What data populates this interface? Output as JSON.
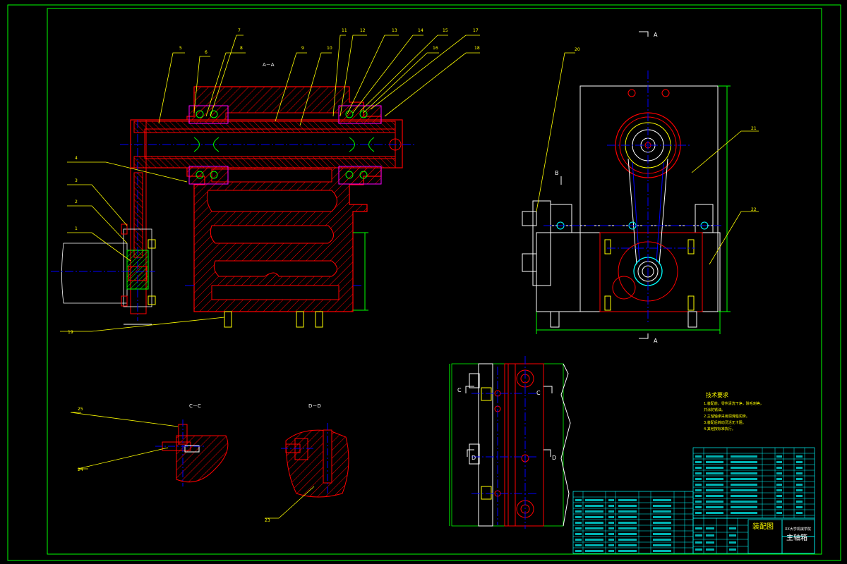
{
  "views": {
    "section_aa": "A－A",
    "section_cc": "C－C",
    "section_dd": "D－D"
  },
  "callouts": {
    "main": [
      "7",
      "5",
      "6",
      "8",
      "9",
      "10",
      "11",
      "12",
      "13",
      "14",
      "15",
      "17",
      "16",
      "18",
      "4",
      "3",
      "2",
      "1",
      "19"
    ],
    "side": [
      "20",
      "21",
      "22"
    ],
    "detail": [
      "25",
      "24",
      "23"
    ]
  },
  "cut_marks": {
    "a_top": "A",
    "a_bottom": "A",
    "b": "B",
    "c_left": "C",
    "c_right": "C",
    "d_left": "D",
    "d_right": "D"
  },
  "technical_requirements": {
    "heading": "技术要求",
    "lines": [
      "1.装配前，零件清洗干净，除毛刺等，",
      "  并涂防锈油。",
      "2.主轴轴承采用润滑脂润滑。",
      "3.装配后转动灵活无卡阻。",
      "4.其他按标准执行。"
    ]
  },
  "title_block": {
    "drawing_type": "装配图",
    "drawing_name": "主轴箱",
    "company": "XX大学机械学院"
  },
  "colors": {
    "outline": "#00ff00",
    "part": "#ff0000",
    "hatch": "#ff0000",
    "center": "#0000ff",
    "leader": "#ffff00",
    "dimension": "#00ff00",
    "table_line": "#00ffff",
    "accent": "#ff00ff"
  }
}
